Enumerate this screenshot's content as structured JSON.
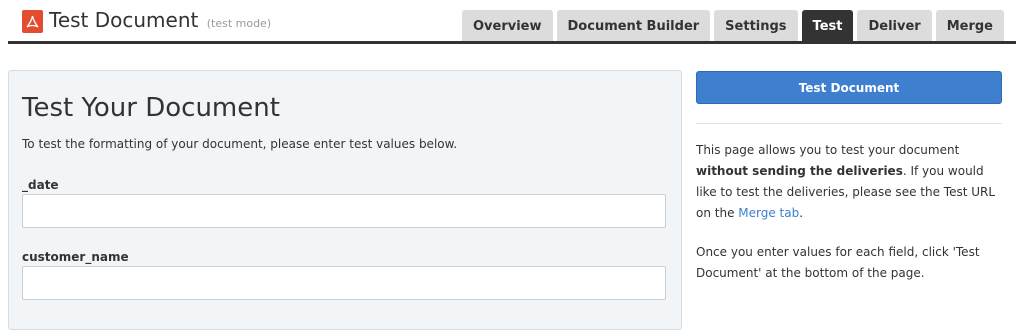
{
  "header": {
    "title": "Test Document",
    "mode": "(test mode)",
    "logo_icon": "pdf-icon",
    "tabs": [
      {
        "label": "Overview",
        "active": false
      },
      {
        "label": "Document Builder",
        "active": false
      },
      {
        "label": "Settings",
        "active": false
      },
      {
        "label": "Test",
        "active": true
      },
      {
        "label": "Deliver",
        "active": false
      },
      {
        "label": "Merge",
        "active": false
      }
    ]
  },
  "main": {
    "heading": "Test Your Document",
    "intro": "To test the formatting of your document, please enter test values below.",
    "fields": [
      {
        "label": "_date",
        "value": ""
      },
      {
        "label": "customer_name",
        "value": ""
      }
    ]
  },
  "sidebar": {
    "button_label": "Test Document",
    "p1_before": "This page allows you to test your document ",
    "p1_bold": "without sending the deliveries",
    "p1_after": ". If you would like to test the deliveries, please see the Test URL on the ",
    "p1_link": "Merge tab",
    "p1_end": ".",
    "p2": "Once you enter values for each field, click 'Test Document' at the bottom of the page."
  },
  "colors": {
    "accent": "#3f7fcf",
    "active_tab": "#333333",
    "logo": "#e34c2f",
    "panel_bg": "#f2f5f8"
  }
}
